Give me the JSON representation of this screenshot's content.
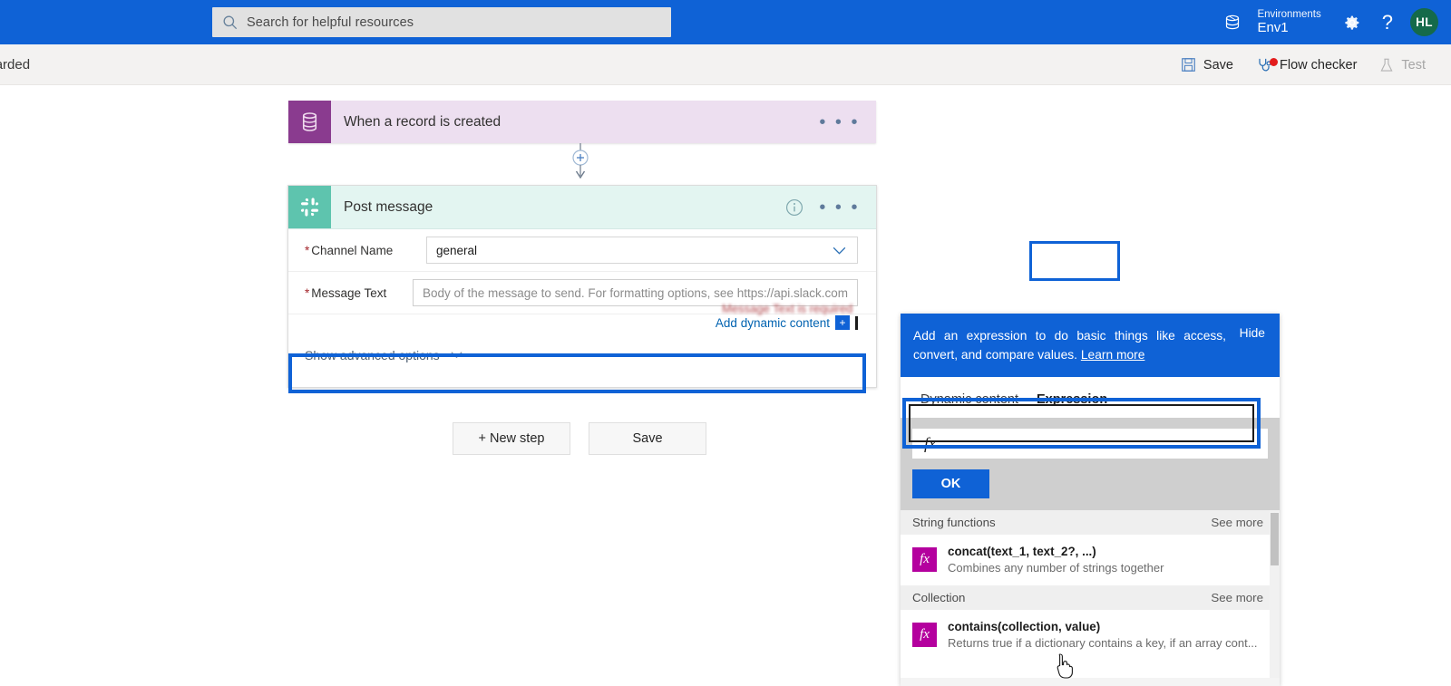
{
  "topbar": {
    "search": {
      "placeholder": "Search for helpful resources",
      "icon": "search-icon"
    },
    "waffle_icon": "environments-globe-icon",
    "environments_label": "Environments",
    "environment_name": "Env1",
    "settings_icon": "gear-icon",
    "help_icon": "help-question-icon",
    "avatar_initials": "HL"
  },
  "toolbar": {
    "breadcrumb": "Onboarded",
    "save_label": "Save",
    "flow_checker_label": "Flow checker",
    "test_label": "Test",
    "save_icon": "save-disk-icon",
    "flow_checker_icon": "stethoscope-icon",
    "test_icon": "flask-icon"
  },
  "designer": {
    "trigger": {
      "title": "When a record is created",
      "icon": "database-icon",
      "icon_color": "#8a3b8f",
      "body_color": "#eddff0",
      "menu": "• • •"
    },
    "connector_icon": "add-step-plus-icon",
    "action": {
      "title": "Post message",
      "icon": "slack-hash-icon",
      "icon_color": "#5ec4ae",
      "header_color": "#e3f5f1",
      "info_icon": "info-icon",
      "menu": "• • •",
      "fields": [
        {
          "label": "Channel Name",
          "required": true,
          "value": "general",
          "is_placeholder": false
        },
        {
          "label": "Message Text",
          "required": true,
          "value": "Body of the message to send. For formatting options, see https://api.slack.com",
          "is_placeholder": true
        }
      ],
      "validation_text": "Message Text is required",
      "add_dynamic_content": "Add dynamic content",
      "add_dynamic_plus": "+",
      "show_advanced": "Show advanced options"
    },
    "buttons": {
      "new_step": "+ New step",
      "save": "Save"
    }
  },
  "expression_panel": {
    "banner": {
      "text": "Add an expression to do basic things like access, convert, and compare values.",
      "link": "Learn more",
      "hide": "Hide"
    },
    "tabs": [
      {
        "label": "Dynamic content",
        "active": false
      },
      {
        "label": "Expression",
        "active": true
      }
    ],
    "fx_symbol": "fx",
    "fx_value": "",
    "ok_label": "OK",
    "sections": [
      {
        "title": "String functions",
        "see_more": "See more",
        "items": [
          {
            "name": "concat(text_1, text_2?, ...)",
            "desc": "Combines any number of strings together",
            "icon": "fx-icon",
            "highlighted": true
          }
        ]
      },
      {
        "title": "Collection",
        "see_more": "See more",
        "items": [
          {
            "name": "contains(collection, value)",
            "desc": "Returns true if a dictionary contains a key, if an array cont...",
            "icon": "fx-icon",
            "highlighted": false
          }
        ]
      }
    ]
  },
  "colors": {
    "brand_blue": "#0f62d6",
    "annotation_blue": "#0f62d6",
    "slack_teal": "#5ec4ae",
    "dataverse_purple": "#8a3b8f",
    "fx_magenta": "#b4009e",
    "required_red": "#a4262c"
  }
}
